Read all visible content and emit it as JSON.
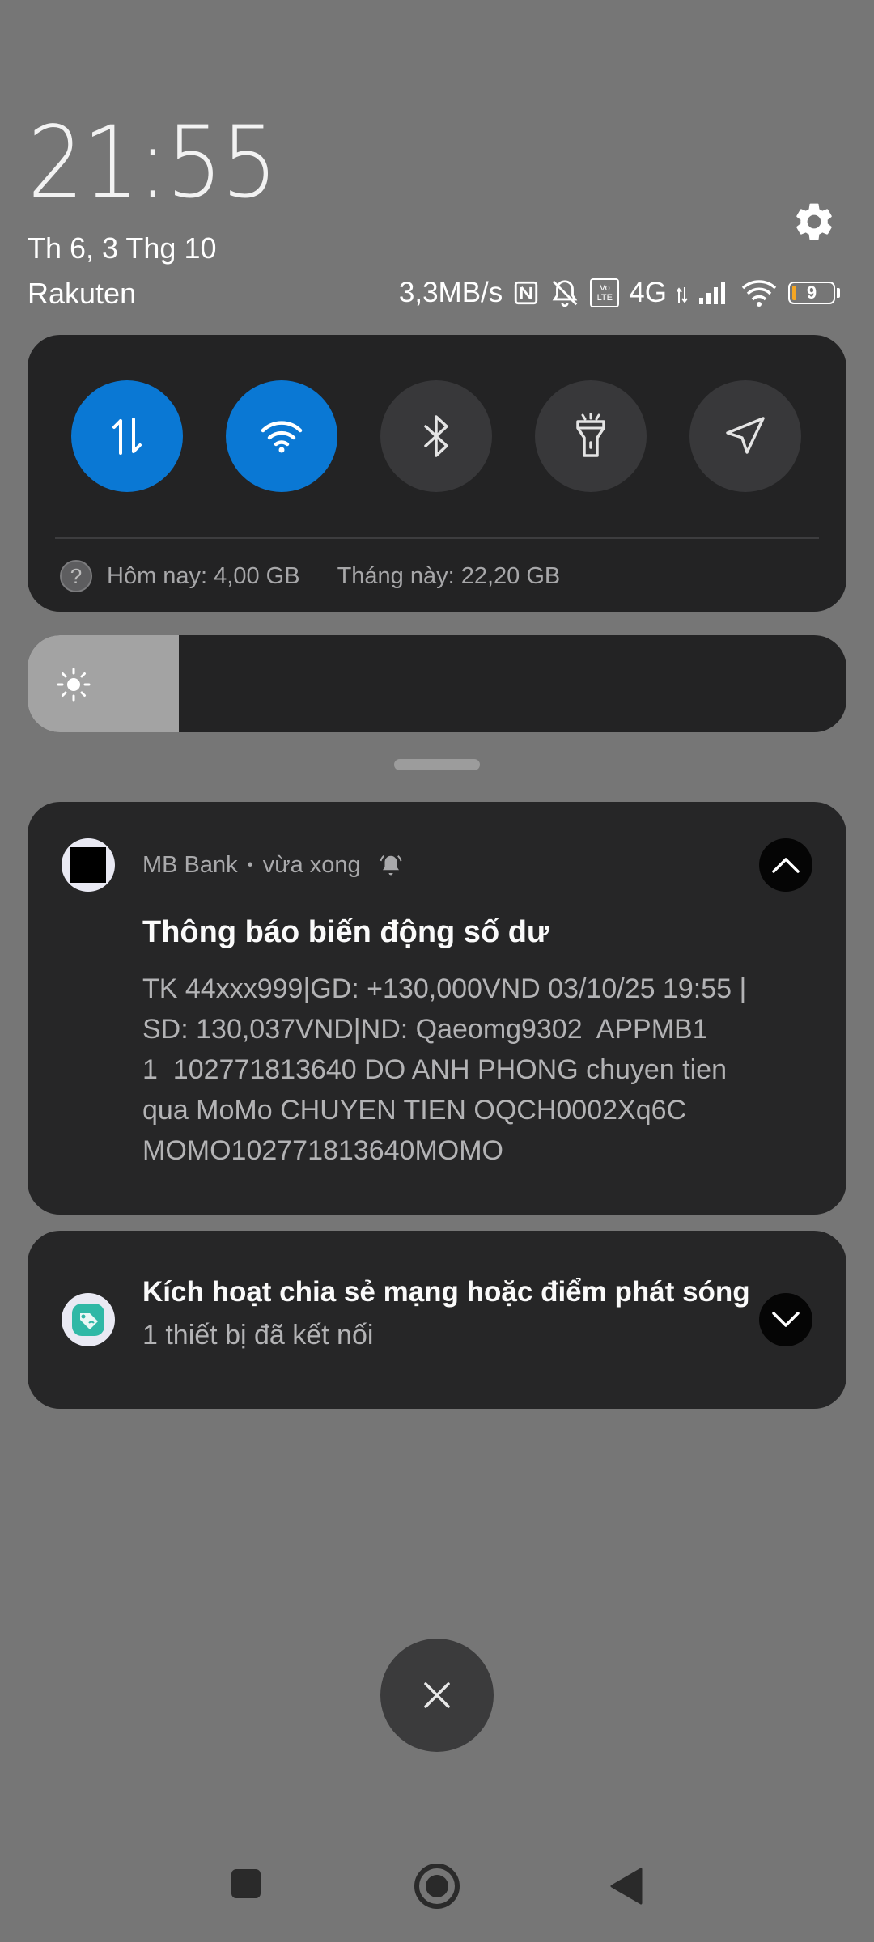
{
  "header": {
    "time": "21:55",
    "date": "Th 6, 3 Thg 10",
    "carrier": "Rakuten",
    "network_speed": "3,3MB/s",
    "network_type": "4G",
    "volte_badge_top": "Vo",
    "volte_badge_bottom": "LTE",
    "battery_level": "9"
  },
  "quick_settings": {
    "tiles": [
      {
        "name": "mobile-data",
        "icon": "data-transfer-icon",
        "active": true
      },
      {
        "name": "wifi",
        "icon": "wifi-icon",
        "active": true
      },
      {
        "name": "bluetooth",
        "icon": "bluetooth-icon",
        "active": false
      },
      {
        "name": "flashlight",
        "icon": "flashlight-icon",
        "active": false
      },
      {
        "name": "location",
        "icon": "location-arrow-icon",
        "active": false
      }
    ],
    "help_glyph": "?",
    "usage_today": "Hôm nay: 4,00 GB",
    "usage_month": "Tháng này: 22,20 GB",
    "brightness_level": 0.185
  },
  "notifications": [
    {
      "app": "MB Bank",
      "separator": "•",
      "time": "vừa xong",
      "title": "Thông báo biến động số dư",
      "body": "TK 44xxx999|GD: +130,000VND 03/10/25 19:55 |\nSD: 130,037VND|ND: Qaeomg9302  APPMB1\n1  102771813640 DO ANH PHONG chuyen tien\nqua MoMo CHUYEN TIEN OQCH0002Xq6C\nMOMO102771813640MOMO"
    },
    {
      "title": "Kích hoạt chia sẻ mạng hoặc điểm phát sóng",
      "subtitle": "1 thiết bị đã kết nối"
    }
  ],
  "colors": {
    "background": "#767676",
    "panel": "#232324",
    "accent": "#0a78d4",
    "tile_off": "#38383a"
  }
}
